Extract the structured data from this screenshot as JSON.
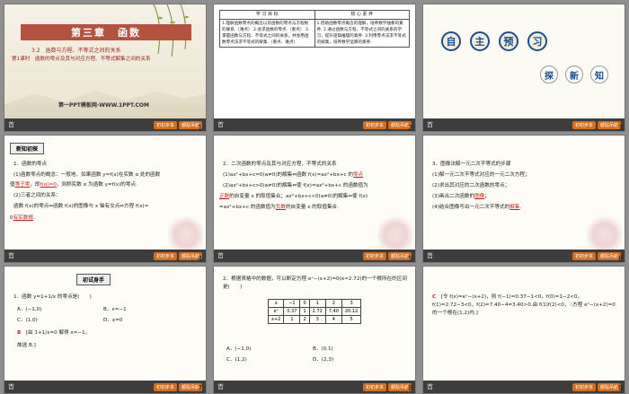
{
  "slides": [
    {
      "number": "1",
      "chapter_title": "第三章　函数",
      "section": "3.2　函数与方程、不等式之间的关系",
      "lesson": "第1课时　函数的零点及其与对应方程、不等式解集之间的关系",
      "brand": "第一PPT模板网-WWW.1PPT.COM"
    },
    {
      "number": "2",
      "col1_header": "学 习 目 标",
      "col2_header": "核 心 素 养",
      "col1_text": "1.理解函数零点的概念以及函数的零点与方程根的联系.（难点）  2.会求函数的零点.（重点）  3.掌握函数与方程、不等式之间的关系，并会用函数零点法求不等式的解集.（重点、难点）",
      "col2_text": "1.借助函数零点概念的理解，培养数学抽象的素养.  2.通过函数与方程、不等式之间的关系的学习，提升逻辑推理的素养.  3.利用零点法求不等式的解集，培养数学运算的素养."
    },
    {
      "number": "3",
      "chars1": [
        "自",
        "主",
        "预",
        "习"
      ],
      "chars2": [
        "探",
        "新",
        "知"
      ]
    },
    {
      "number": "4",
      "box_label": "新知初探",
      "l1": "1．函数的零点",
      "l2": "(1)函数零点的概念：一般地，如果函数 y=f(x)在实数 α 处的函数",
      "l3_pre": "值",
      "l3_red1": "等于零",
      "l3_mid": "，即",
      "l3_red2": "f(α)=0",
      "l3_post": "，则称实数 α 为函数 y=f(x)的零点.",
      "l4": "(2)三者之间的关系：",
      "l5": "函数 f(x)的零点⇔函数 f(x)的图像与 x 轴有交点⇔方程 f(x)=",
      "l6_pre": "0",
      "l6_red": "有实数根",
      "l6_post": "."
    },
    {
      "number": "5",
      "l1": "2．二次函数的零点及其与对应方程、不等式的关系",
      "l2_pre": "(1)ax²+bx+c=0(a≠0)的解集⇔函数 f(x)=ax²+bx+c 的",
      "l2_red": "零点",
      "l3_pre": "(2)ax²+bx+c>0(a≠0)的解集⇔使 f(x)=ax²+bx+c 的函数值为",
      "l4_red": "正数",
      "l4_post": "的自变量 x 的取值集合；ax²+bx+c<0(a≠0)的解集⇔使 f(x)",
      "l5_pre": "=ax²+bx+c 的函数值为",
      "l5_red": "负数",
      "l5_post": "的自变量 x 的取值集合."
    },
    {
      "number": "6",
      "l1": "3．图像法解一元二次不等式的步骤",
      "l2": "(1)解一元二次不等式对应的一元二次方程；",
      "l3": "(2)求出其对应的二次函数的零点；",
      "l4_pre": "(3)画出二次函数的",
      "l4_red": "图像",
      "l4_post": "；",
      "l5_pre": "(4)结合图像写出一元二次不等式的",
      "l5_red": "解集",
      "l5_post": "."
    },
    {
      "number": "7",
      "box_label": "初试身手",
      "q": "1．函数 y=1+1/x 的零点是(　　)",
      "optA": "A．(−1,0)",
      "optB": "B．x=−1",
      "optC": "C．(1,0)",
      "optD": "D．x=0",
      "ans_red": "B",
      "ans_text": "[由 1+1/x=0 解得 x=−1，",
      "ans_end": "故选 B.]"
    },
    {
      "number": "8",
      "q": "2．根据表格中的数据，可以断定方程 eˣ−(x+2)=0(e≈2.72)的一个根所在的区间是(　　)",
      "table": [
        [
          "x",
          "−1",
          "0",
          "1",
          "2",
          "3"
        ],
        [
          "eˣ",
          "0.37",
          "1",
          "2.72",
          "7.40",
          "20.12"
        ],
        [
          "x+2",
          "1",
          "2",
          "3",
          "4",
          "5"
        ]
      ],
      "optA": "A．(−1,0)",
      "optB": "B．(0,1)",
      "optC": "C．(1,2)",
      "optD": "D．(2,3)"
    },
    {
      "number": "9",
      "ans_red": "C",
      "text": "[令 f(x)=eˣ−(x+2)，则 f(−1)=0.37−1<0，f(0)=1−2<0，f(1)=2.72−3<0，f(2)=7.40−4=3.40>0.由 f(1)f(2)<0，∴方程 eˣ−(x+2)=0 的一个根在(1,2)内.]"
    }
  ],
  "footer": {
    "home": "首",
    "btn1": "初初步本",
    "btn2": "都贴吊航"
  }
}
